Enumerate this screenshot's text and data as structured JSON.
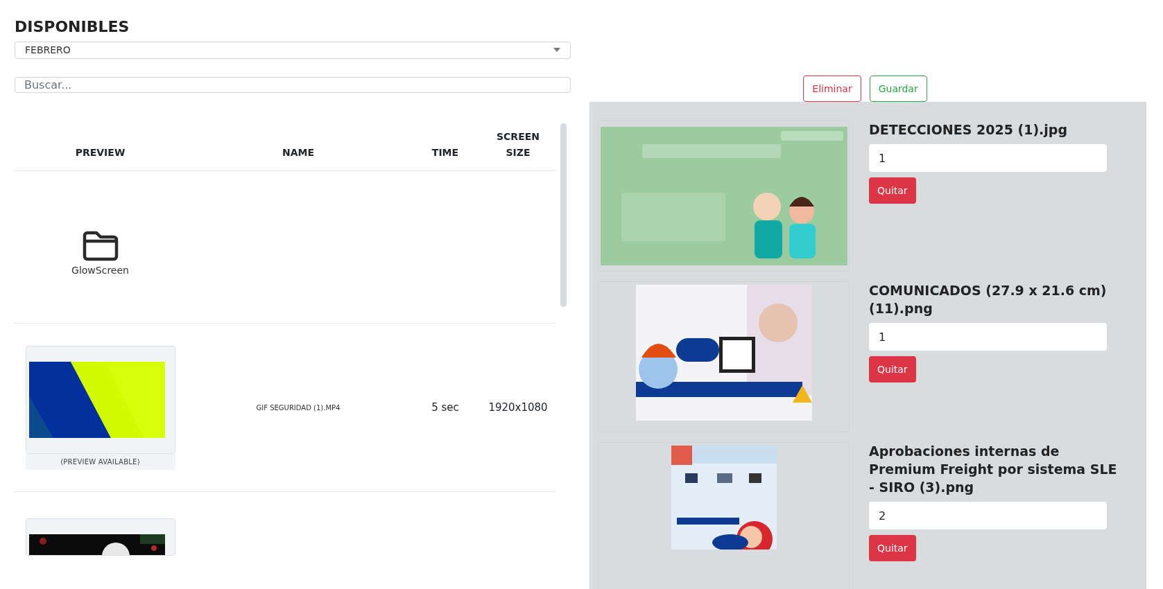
{
  "heading": "DISPONIBLES",
  "month_select": {
    "value": "FEBRERO"
  },
  "search": {
    "placeholder": "Buscar..."
  },
  "table": {
    "columns": [
      "PREVIEW",
      "NAME",
      "TIME",
      "SCREEN SIZE"
    ],
    "rows": [
      {
        "kind": "folder",
        "label": "GlowScreen"
      },
      {
        "kind": "media",
        "caption": "(PREVIEW AVAILABLE)",
        "name": "GIF SEGURIDAD (1).MP4",
        "time": "5 sec",
        "screen_size": "1920x1080"
      },
      {
        "kind": "media"
      }
    ]
  },
  "actions": [
    {
      "label": "Eliminar",
      "kind": "danger"
    },
    {
      "label": "Guardar",
      "kind": "success"
    }
  ],
  "playlist": [
    {
      "name": "DETECCIONES 2025 (1).jpg",
      "value": "1",
      "remove": "Quitar"
    },
    {
      "name": "COMUNICADOS (27.9 x 21.6 cm) (11).png",
      "value": "1",
      "remove": "Quitar"
    },
    {
      "name": "Aprobaciones internas de Premium Freight por sistema SLE - SIRO (3).png",
      "value": "2",
      "remove": "Quitar"
    }
  ]
}
